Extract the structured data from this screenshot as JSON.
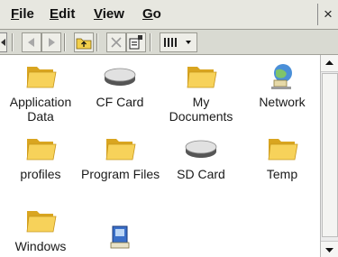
{
  "menu": {
    "file": {
      "ul": "F",
      "rest": "ile"
    },
    "edit": {
      "ul": "E",
      "rest": "dit"
    },
    "view": {
      "ul": "V",
      "rest": "iew"
    },
    "go": {
      "ul": "G",
      "rest": "o"
    }
  },
  "close_glyph": "×",
  "toolbar_icons": [
    "back-arrow-icon",
    "forward-arrow-icon",
    "up-folder-icon",
    "delete-icon",
    "properties-icon",
    "view-mode-icon"
  ],
  "items": [
    {
      "label_line1": "Application",
      "label_line2": "Data",
      "icon": "folder-icon"
    },
    {
      "label_line1": "CF Card",
      "label_line2": "",
      "icon": "storage-card-icon"
    },
    {
      "label_line1": "My",
      "label_line2": "Documents",
      "icon": "folder-icon"
    },
    {
      "label_line1": "Network",
      "label_line2": "",
      "icon": "network-icon"
    },
    {
      "label_line1": "profiles",
      "label_line2": "",
      "icon": "folder-icon"
    },
    {
      "label_line1": "Program Files",
      "label_line2": "",
      "icon": "folder-icon"
    },
    {
      "label_line1": "SD Card",
      "label_line2": "",
      "icon": "storage-card-icon"
    },
    {
      "label_line1": "Temp",
      "label_line2": "",
      "icon": "folder-icon"
    },
    {
      "label_line1": "Windows",
      "label_line2": "",
      "icon": "folder-icon"
    },
    {
      "label_line1": "",
      "label_line2": "",
      "icon": "shortcut-app-icon"
    }
  ],
  "colors": {
    "folder": "#f7d25a",
    "folder_dark": "#d9a520",
    "menubar": "#e7e7e0",
    "toolbar": "#d9dad2"
  }
}
